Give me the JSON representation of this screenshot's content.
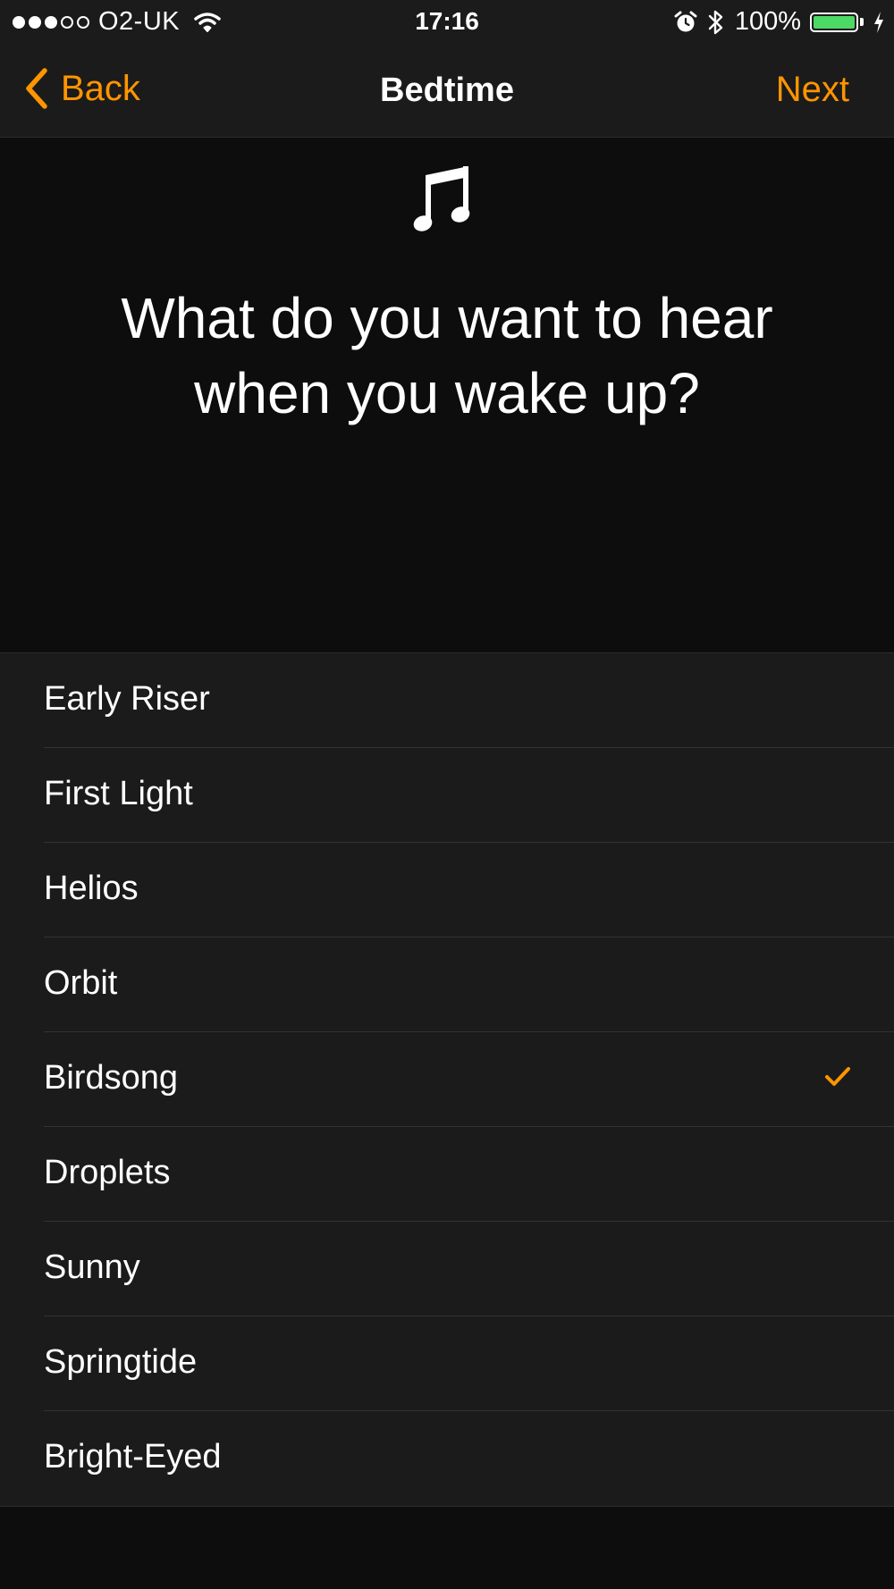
{
  "status_bar": {
    "carrier": "O2-UK",
    "signal": {
      "filled": 3,
      "total": 5
    },
    "time": "17:16",
    "battery_percent": "100%",
    "battery_level": 1.0,
    "icons": [
      "wifi-icon",
      "alarm-icon",
      "bluetooth-icon",
      "battery-icon",
      "charging-bolt-icon"
    ]
  },
  "nav": {
    "back_label": "Back",
    "title": "Bedtime",
    "next_label": "Next"
  },
  "header": {
    "icon": "music-note-icon",
    "question_line1": "What do you want to hear",
    "question_line2": "when you wake up?"
  },
  "sounds": {
    "items": [
      {
        "label": "Early Riser",
        "selected": false
      },
      {
        "label": "First Light",
        "selected": false
      },
      {
        "label": "Helios",
        "selected": false
      },
      {
        "label": "Orbit",
        "selected": false
      },
      {
        "label": "Birdsong",
        "selected": true
      },
      {
        "label": "Droplets",
        "selected": false
      },
      {
        "label": "Sunny",
        "selected": false
      },
      {
        "label": "Springtide",
        "selected": false
      },
      {
        "label": "Bright-Eyed",
        "selected": false
      }
    ]
  },
  "colors": {
    "accent": "#ff9500",
    "battery": "#4cd964",
    "background": "#0d0d0d",
    "surface": "#1b1b1b"
  }
}
